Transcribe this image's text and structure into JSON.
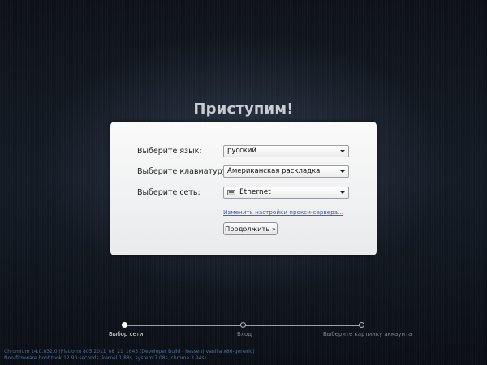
{
  "title": "Приступим!",
  "form": {
    "language": {
      "label": "Выберите язык:",
      "value": "русский"
    },
    "keyboard": {
      "label": "Выберите клавиатуру:",
      "value": "Американская раскладка"
    },
    "network": {
      "label": "Выберите сеть:",
      "value": "Ethernet",
      "icon": "ethernet-icon"
    },
    "proxy_link": "Изменить настройки прокси-сервера...",
    "continue_label": "Продолжить »"
  },
  "steps": [
    {
      "label": "Выбор сети",
      "active": true
    },
    {
      "label": "Вход",
      "active": false
    },
    {
      "label": "Выберите картинку аккаунта",
      "active": false
    }
  ],
  "version_info": {
    "line1": "Chromium 14.0.832.0 (Platform 805.2011_08_21_1643 (Developer Build - hessen) vanilla x86-generic)",
    "line2": "Non-firmware boot took 12.90 seconds (kernel 1.88s, system 7.08s, chrome 3.94s)"
  }
}
